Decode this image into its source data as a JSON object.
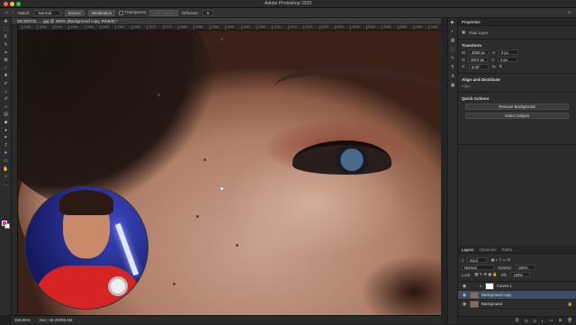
{
  "window": {
    "title": "Adobe Photoshop 2020"
  },
  "options": {
    "match_label": "Match:",
    "match_value": "Normal",
    "source_btn": "Source",
    "destination_btn": "Destination",
    "transparent_label": "Transparent",
    "use_pattern_label": "Use Pattern",
    "diffusion_label": "Diffusion:",
    "diffusion_value": "5"
  },
  "document": {
    "tab_title": "MC303731 ... .jpg @ 360% (Background copy, RGB/8) *",
    "zoom": "359.85%",
    "doc_size": "Doc: 48.2M/99.5M"
  },
  "ruler": {
    "ticks": [
      "1930",
      "1935",
      "1940",
      "1945",
      "1950",
      "1955",
      "1960",
      "1965",
      "1970",
      "1975",
      "1980",
      "1985",
      "1990",
      "1995",
      "2000",
      "2005",
      "2010",
      "2015",
      "2020",
      "2025",
      "2030",
      "2035",
      "2040",
      "2045",
      "2050",
      "2055",
      "2060"
    ]
  },
  "properties": {
    "tabs": [
      "Properties"
    ],
    "pixel_layer": "Pixel Layer",
    "transform_title": "Transform",
    "w_label": "W",
    "w_value": "3000 px",
    "x_label": "X",
    "x_value": "0 px",
    "h_label": "H",
    "h_value": "3972 px",
    "y_label": "Y",
    "y_value": "0 px",
    "angle_value": "0.00°",
    "align_title": "Align and Distribute",
    "align_sub": "Align:",
    "quick_title": "Quick Actions",
    "remove_bg": "Remove Background",
    "select_subject": "Select Subject"
  },
  "layers_panel": {
    "tabs": [
      "Layers",
      "Channels",
      "Paths"
    ],
    "kind_label": "Kind",
    "blend_mode": "Normal",
    "opacity_label": "Opacity:",
    "opacity_value": "100%",
    "lock_label": "Lock:",
    "fill_label": "Fill:",
    "fill_value": "100%",
    "layers": [
      {
        "name": "Curves 1"
      },
      {
        "name": "Background copy"
      },
      {
        "name": "Background"
      }
    ]
  },
  "colors": {
    "foreground": "#e61ea0",
    "background": "#ffffff",
    "selected_layer": "#3d4e66"
  }
}
